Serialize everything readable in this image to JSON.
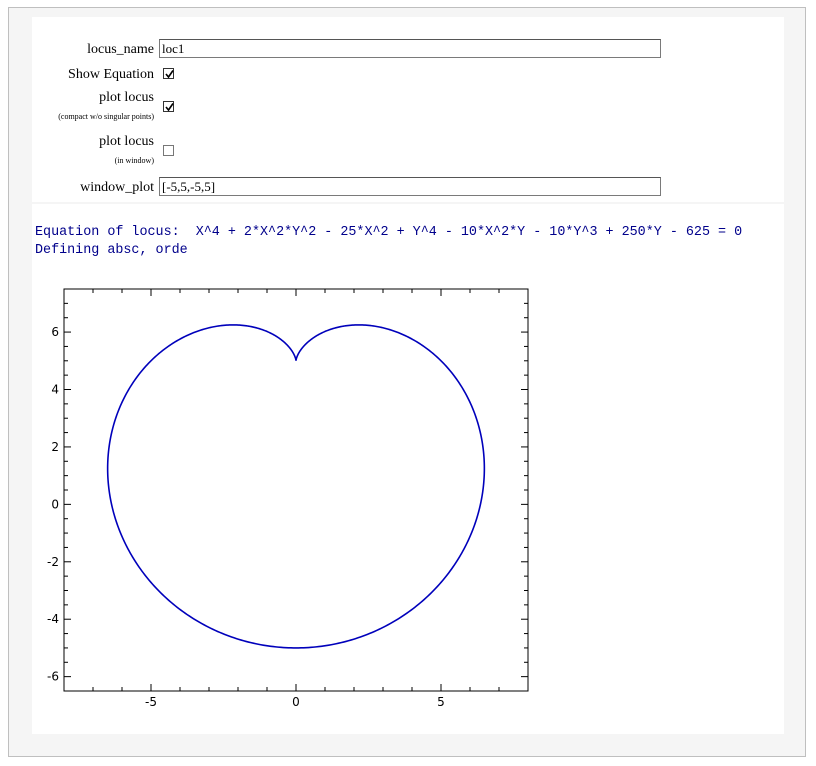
{
  "form": {
    "locus_name": {
      "label": "locus_name",
      "value": "loc1"
    },
    "show_equation": {
      "label": "Show Equation",
      "checked": true
    },
    "plot_locus_compact": {
      "label": "plot locus",
      "sublabel": "(compact w/o singular points)",
      "checked": true
    },
    "plot_locus_window": {
      "label": "plot locus",
      "sublabel": "(in window)",
      "checked": false
    },
    "window_plot": {
      "label": "window_plot",
      "value": "[-5,5,-5,5]"
    }
  },
  "output": {
    "equation_line": "Equation of locus:  X^4 + 2*X^2*Y^2 - 25*X^2 + Y^4 - 10*X^2*Y - 10*Y^3 + 250*Y - 625 = 0",
    "defining_line": "Defining absc, orde"
  },
  "chart_data": {
    "type": "line",
    "equation": "X^4 + 2*X^2*Y^2 - 25*X^2 + Y^4 - 10*X^2*Y - 10*Y^3 + 250*Y - 625 = 0",
    "parametric": {
      "r": "5*(1 - sin(t))",
      "x": "r*cos(t)",
      "y": "r*sin(t) + 5",
      "t_range": [
        0,
        6.2832
      ]
    },
    "xlim": [
      -8,
      8
    ],
    "ylim": [
      -6.5,
      7.5
    ],
    "xticks": [
      -5,
      0,
      5
    ],
    "xtick_labels": [
      "-5",
      "0",
      "5"
    ],
    "yticks": [
      -6,
      -4,
      -2,
      0,
      2,
      4,
      6
    ],
    "ytick_labels": [
      "-6",
      "-4",
      "-2",
      "0",
      "2",
      "4",
      "6"
    ],
    "series_color": "#0000bb",
    "grid": false
  }
}
